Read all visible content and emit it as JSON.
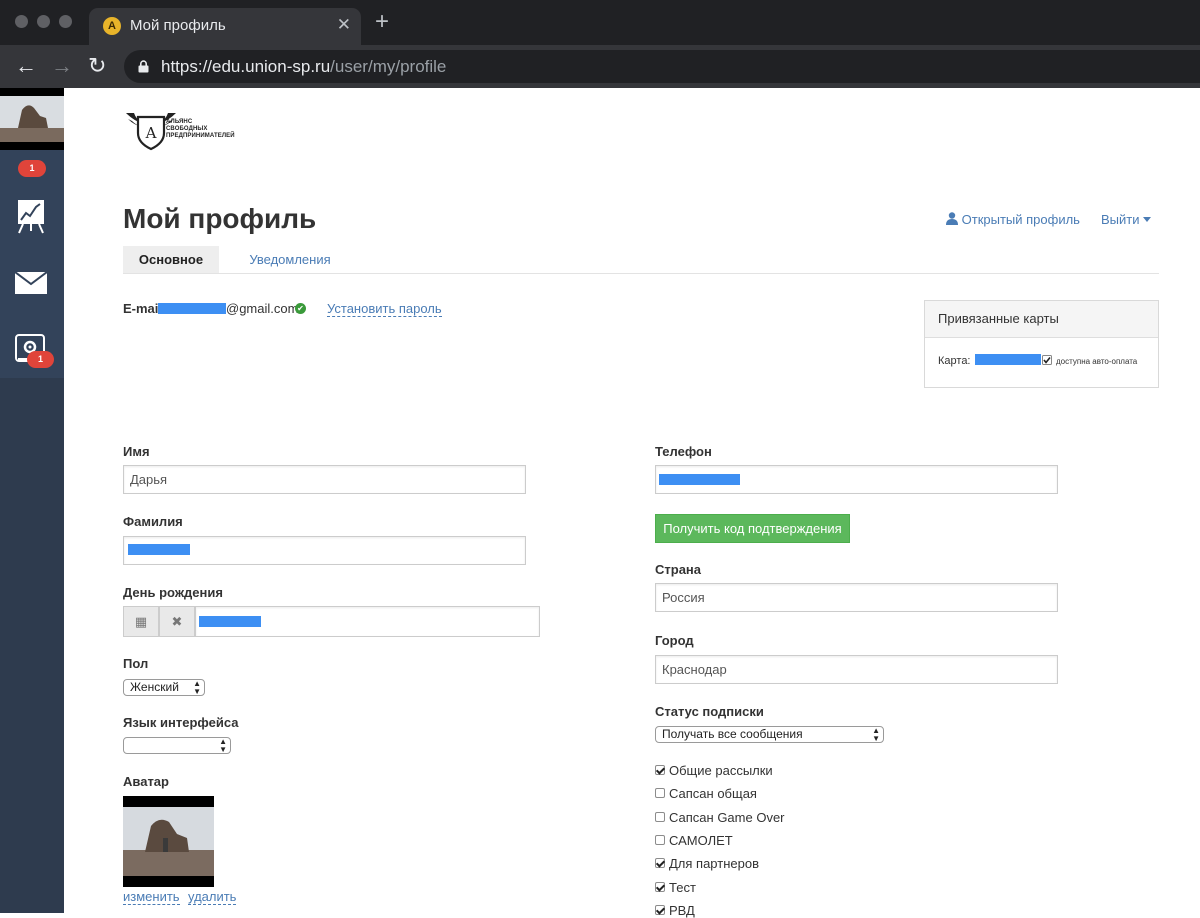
{
  "browser": {
    "tab_title": "Мой профиль",
    "new_tab_symbol": "+",
    "close_symbol": "✕",
    "favicon_letter": "A",
    "url_host": "https://edu.union-sp.ru",
    "url_path": "/user/my/profile",
    "back_symbol": "←",
    "forward_symbol": "→",
    "reload_symbol": "↻"
  },
  "sidebar": {
    "items": [
      {
        "name": "avatar",
        "badge": "1"
      },
      {
        "name": "chart-easel-icon",
        "badge": ""
      },
      {
        "name": "mail-icon",
        "badge": ""
      },
      {
        "name": "settings-icon",
        "badge": "1"
      }
    ]
  },
  "header": {
    "logo_text": [
      "Альянс",
      "свободных",
      "предпринимателей"
    ],
    "logo_letter": "A",
    "page_title": "Мой профиль",
    "open_profile": "Открытый профиль",
    "logout": "Выйти"
  },
  "tabs": [
    {
      "label": "Основное",
      "active": true
    },
    {
      "label": "Уведомления",
      "active": false
    }
  ],
  "email": {
    "label": "E-mail",
    "domain": "@gmail.com",
    "set_password": "Установить пароль"
  },
  "cards": {
    "title": "Привязанные карты",
    "card_label": "Карта:",
    "auto_pay": "доступна авто-оплата"
  },
  "form_left": {
    "name_label": "Имя",
    "name_value": "Дарья",
    "surname_label": "Фамилия",
    "birthday_label": "День рождения",
    "calendar_symbol": "▦",
    "clear_symbol": "✖",
    "gender_label": "Пол",
    "gender_value": "Женский",
    "language_label": "Язык интерфейса",
    "language_value": "",
    "avatar_label": "Аватар",
    "avatar_change": "изменить",
    "avatar_delete": "удалить"
  },
  "form_right": {
    "phone_label": "Телефон",
    "get_code_button": "Получить код подтверждения",
    "country_label": "Страна",
    "country_value": "Россия",
    "city_label": "Город",
    "city_value": "Краснодар",
    "subscription_label": "Статус подписки",
    "subscription_value": "Получать все сообщения",
    "checkboxes": [
      {
        "label": "Общие рассылки",
        "checked": true
      },
      {
        "label": "Сапсан общая",
        "checked": false
      },
      {
        "label": "Сапсан Game Over",
        "checked": false
      },
      {
        "label": "САМОЛЕТ",
        "checked": false
      },
      {
        "label": "Для партнеров",
        "checked": true
      },
      {
        "label": "Тест",
        "checked": true
      },
      {
        "label": "РВД",
        "checked": true
      }
    ]
  },
  "colors": {
    "link": "#4a7cb5",
    "green_button": "#5cb85c",
    "sidebar": "#2e3b4e",
    "badge": "#e0443a",
    "redaction": "#3d8ff3"
  }
}
